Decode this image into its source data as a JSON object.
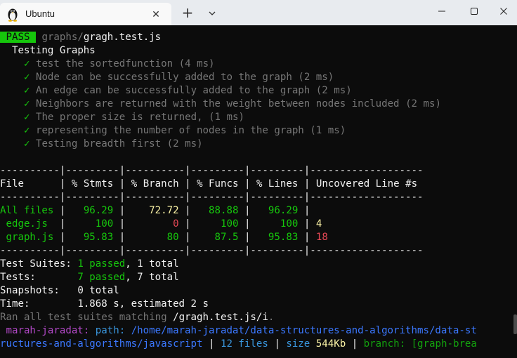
{
  "window": {
    "tab_title": "Ubuntu",
    "close_tab_glyph": "✕",
    "new_tab_glyph": "+",
    "icons": {
      "tab": "tux-penguin-icon",
      "dropdown": "chevron-down-icon",
      "minimize": "minimize-icon",
      "maximize": "maximize-icon",
      "close": "close-icon"
    }
  },
  "run": {
    "status": "PASS",
    "path_dir": "graphs/",
    "path_file": "gragh.test.js",
    "suite_name": "Testing Graphs",
    "check": "✓",
    "tests": [
      {
        "name": "test the sortedfunction",
        "time": "(4 ms)"
      },
      {
        "name": "Node can be successfully added to the graph",
        "time": "(2 ms)"
      },
      {
        "name": "An edge can be successfully added to the graph",
        "time": "(2 ms)"
      },
      {
        "name": "Neighbors are returned with the weight between nodes included",
        "time": "(2 ms)"
      },
      {
        "name": "The proper size is returned,",
        "time": "(1 ms)"
      },
      {
        "name": "representing the number of nodes in the graph",
        "time": "(1 ms)"
      },
      {
        "name": "Testing breadth first",
        "time": "(2 ms)"
      }
    ]
  },
  "coverage": {
    "separator": "----------|---------|----------|---------|---------|-------------------",
    "header": {
      "file": "File",
      "stmts": "% Stmts",
      "branch": "% Branch",
      "funcs": "% Funcs",
      "lines": "% Lines",
      "uncovered": "Uncovered Line #s"
    },
    "rows": [
      {
        "file": "All files",
        "stmts": "96.29",
        "branch": "72.72",
        "funcs": "88.88",
        "lines": "96.29",
        "uncovered": ""
      },
      {
        "file": "edge.js",
        "stmts": "100",
        "branch": "0",
        "funcs": "100",
        "lines": "100",
        "uncovered": "4"
      },
      {
        "file": "graph.js",
        "stmts": "95.83",
        "branch": "80",
        "funcs": "87.5",
        "lines": "95.83",
        "uncovered": "18"
      }
    ]
  },
  "summary": {
    "suites_label": "Test Suites:",
    "suites_passed": "1 passed",
    "suites_total": ", 1 total",
    "tests_label": "Tests:",
    "tests_passed": "7 passed",
    "tests_total": ", 7 total",
    "snapshots_label": "Snapshots:",
    "snapshots_value": "0 total",
    "time_label": "Time:",
    "time_value": "1.868 s, estimated 2 s",
    "ran_prefix": "Ran all test suites matching ",
    "ran_pattern": "/gragh.test.js/i",
    "ran_suffix": "."
  },
  "prompt": {
    "user": " marah-jaradat:",
    "path_label": " path: ",
    "path_part1": "/home/marah-jaradat/data-structures-and-algorithms/data-st",
    "path_part2": "ructures-and-algorithms/javascript",
    "sep": " | ",
    "files": "12 files",
    "size_label": "size ",
    "size_value": "544Kb",
    "branch_label": "branch: ",
    "branch_value": "[graph-brea"
  },
  "colors": {
    "background": "#0c0c0c",
    "pass_green": "#16c60c",
    "warn_yellow": "#f9f1a5",
    "error_red": "#e74856",
    "prompt_magenta": "#b148c6",
    "path_blue": "#3b78ff"
  }
}
